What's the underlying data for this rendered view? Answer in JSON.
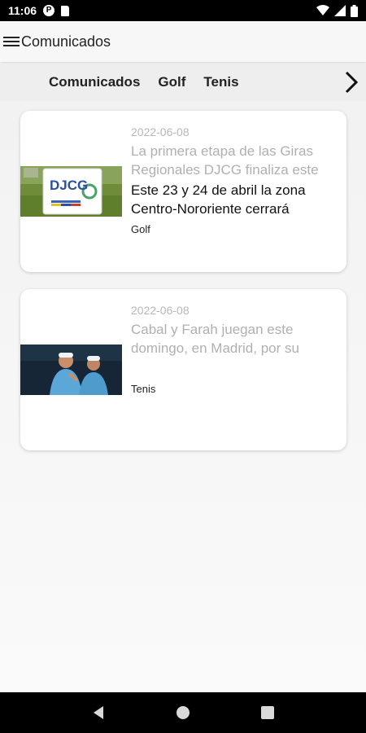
{
  "status_bar": {
    "time": "11:06",
    "icons": [
      "p-icon",
      "sd-card-icon",
      "wifi-icon",
      "signal-icon",
      "battery-icon"
    ]
  },
  "app_bar": {
    "title": "Comunicados",
    "menu_icon": "menu-icon"
  },
  "tabs": {
    "items": [
      {
        "label": "Comunicados"
      },
      {
        "label": "Golf"
      },
      {
        "label": "Tenis"
      }
    ],
    "next_icon": "chevron-right-icon"
  },
  "cards": [
    {
      "date": "2022-06-08",
      "title": "La primera etapa de las Giras Regionales DJCG finaliza este",
      "summary": "Este 23 y 24 de abril la zona Centro-Nororiente cerrará",
      "category": "Golf",
      "image": "golf-sign-image",
      "image_text": "DJCG"
    },
    {
      "date": "2022-06-08",
      "title": "Cabal y Farah juegan este domingo, en Madrid, por su",
      "summary": "",
      "category": "Tenis",
      "image": "tennis-players-image"
    }
  ],
  "nav_bar": {
    "icons": [
      "back-icon",
      "home-icon",
      "recents-icon"
    ]
  },
  "colors": {
    "status_bar": "#000000",
    "app_bar": "#f7f7f7",
    "tab_bar": "#eeeeee",
    "muted_text": "#b0b0b0"
  }
}
